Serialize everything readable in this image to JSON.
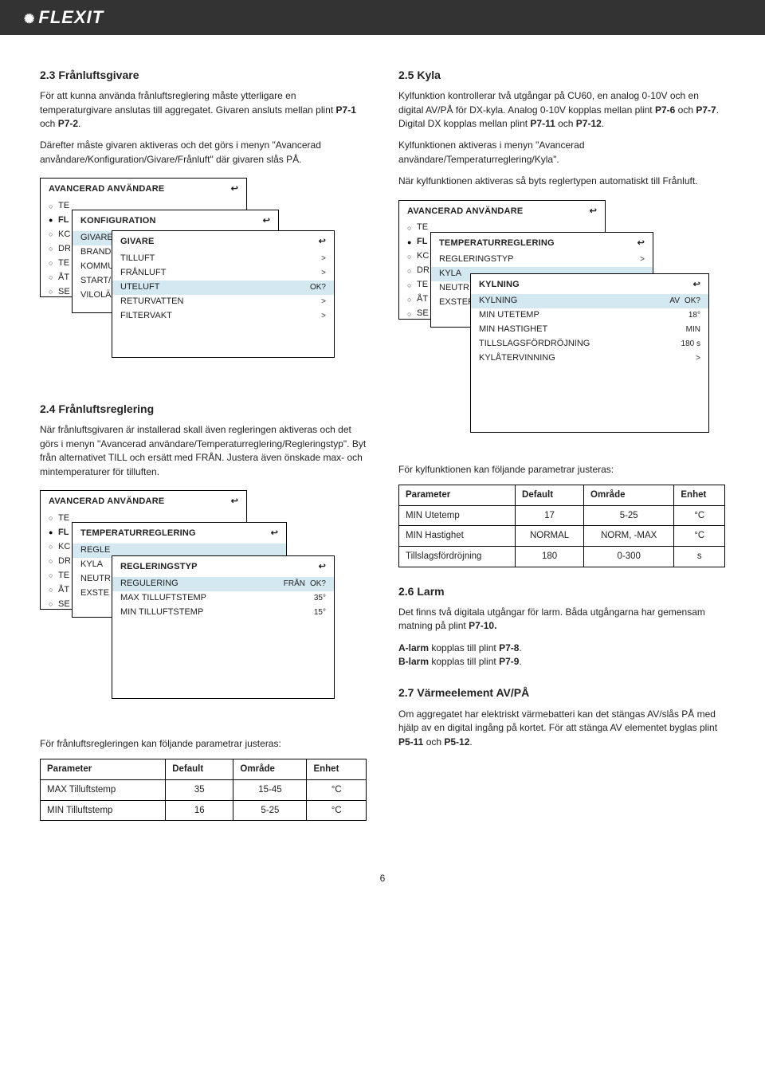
{
  "brand": "FLEXIT",
  "s23": {
    "heading": "2.3 Frånluftsgivare",
    "p1a": "För att kunna använda frånluftsreglering måste ytterligare en temperaturgivare anslutas till aggregatet. Givaren ansluts mellan plint ",
    "p1b": "P7-1",
    "p1c": " och ",
    "p1d": "P7-2",
    "p1e": ".",
    "p2": "Därefter måste givaren aktiveras och det görs i menyn \"Avancerad anvåndare/Konfiguration/Givare/Frånluft\" där givaren slås PÅ."
  },
  "cascades23": {
    "m1_title": "AVANCERAD ANVÄNDARE",
    "m1_items": [
      "TE",
      "FL",
      "KC",
      "DR",
      "TE",
      "ÅT",
      "SE"
    ],
    "m2_title": "KONFIGURATION",
    "m2_items": [
      "GIVARE",
      "BRAND",
      "KOMMU",
      "START/",
      "VILOLÄ"
    ],
    "m3_title": "GIVARE",
    "m3_rows": [
      {
        "label": "TILLUFT",
        "chev": ">"
      },
      {
        "label": "FRÅNLUFT",
        "chev": ">"
      },
      {
        "label": "UTELUFT",
        "chev": "",
        "ok": "OK?",
        "selected": true
      },
      {
        "label": "RETURVATTEN",
        "chev": ">"
      },
      {
        "label": "FILTERVAKT",
        "chev": ">"
      }
    ]
  },
  "s24": {
    "heading": "2.4 Frånluftsreglering",
    "p1": "När frånluftsgivaren är installerad skall även regleringen aktiveras och det görs i menyn \"Avancerad användare/Temperaturreglering/Regleringstyp\". Byt från alternativet TILL och ersätt med FRÅN. Justera även önskade max- och mintemperaturer för tilluften."
  },
  "cascades24": {
    "m1_title": "AVANCERAD ANVÄNDARE",
    "m1_items": [
      "TE",
      "FL",
      "KC",
      "DR",
      "TE",
      "ÅT",
      "SE"
    ],
    "m2_title": "TEMPERATURREGLERING",
    "m2_items": [
      "REGLE",
      "KYLA",
      "NEUTR",
      "EXSTE"
    ],
    "m3_title": "REGLERINGSTYP",
    "m3_rows": [
      {
        "label": "REGULERING",
        "val": "FRÅN",
        "ok": "OK?",
        "selected": true
      },
      {
        "label": "MAX TILLUFTSTEMP",
        "val": "35°"
      },
      {
        "label": "MIN TILLUFTSTEMP",
        "val": "15°"
      }
    ]
  },
  "s24_tbl_intro": "För frånluftsregleringen kan följande parametrar justeras:",
  "s24_table": {
    "headers": [
      "Parameter",
      "Default",
      "Område",
      "Enhet"
    ],
    "rows": [
      [
        "MAX Tilluftstemp",
        "35",
        "15-45",
        "°C"
      ],
      [
        "MIN Tilluftstemp",
        "16",
        "5-25",
        "°C"
      ]
    ]
  },
  "s25": {
    "heading": "2.5 Kyla",
    "p1a": "Kylfunktion kontrollerar två utgångar på CU60, en analog 0-10V och en digital AV/PÅ för DX-kyla. Analog 0-10V kopplas mellan plint ",
    "p1b": "P7-6",
    "p1c": " och ",
    "p1d": "P7-7",
    "p1e": ". Digital DX kopplas mellan plint ",
    "p1f": "P7-11",
    "p1g": " och ",
    "p1h": "P7-12",
    "p1i": ".",
    "p2": "Kylfunktionen aktiveras i menyn \"Avancerad användare/Temperaturreglering/Kyla\".",
    "p3": "När kylfunktionen aktiveras så byts reglertypen automatiskt till Frånluft."
  },
  "cascades25": {
    "m1_title": "AVANCERAD ANVÄNDARE",
    "m1_items": [
      "TE",
      "FL",
      "KC",
      "DR",
      "TE",
      "ÅT",
      "SE"
    ],
    "m2_title": "TEMPERATURREGLERING",
    "m2_items": [
      "REGLERINGSTYP",
      "KYLA",
      "NEUTR",
      "EXSTER"
    ],
    "m3_title": "KYLNING",
    "m3_rows": [
      {
        "label": "KYLNING",
        "val": "AV",
        "ok": "OK?",
        "selected": true
      },
      {
        "label": "MIN UTETEMP",
        "val": "18°"
      },
      {
        "label": "MIN HASTIGHET",
        "val": "MIN"
      },
      {
        "label": "TILLSLAGSFÖRDRÖJNING",
        "val": "180 s"
      },
      {
        "label": "KYLÅTERVINNING",
        "chev": ">"
      }
    ]
  },
  "s25_tbl_intro": "För kylfunktionen kan följande parametrar justeras:",
  "s25_table": {
    "headers": [
      "Parameter",
      "Default",
      "Område",
      "Enhet"
    ],
    "rows": [
      [
        "MIN Utetemp",
        "17",
        "5-25",
        "°C"
      ],
      [
        "MIN Hastighet",
        "NORMAL",
        "NORM, -MAX",
        "°C"
      ],
      [
        "Tillslagsfördröjning",
        "180",
        "0-300",
        "s"
      ]
    ]
  },
  "s26": {
    "heading": "2.6 Larm",
    "p1a": "Det finns två digitala utgångar för larm. Båda utgångarna har gemensam matning på plint ",
    "p1b": "P7-10.",
    "p2a": "A-larm",
    "p2b": " kopplas till plint ",
    "p2c": "P7-8",
    "p2d": ".",
    "p3a": "B-larm",
    "p3b": " kopplas till plint ",
    "p3c": "P7-9",
    "p3d": "."
  },
  "s27": {
    "heading": "2.7 Värmeelement AV/PÅ",
    "p1a": "Om aggregatet har elektriskt värmebatteri kan det stängas AV/slås PÅ med hjälp av en digital ingång på kortet. För att stänga AV elementet byglas plint ",
    "p1b": "P5-11",
    "p1c": " och ",
    "p1d": "P5-12",
    "p1e": "."
  },
  "page_number": "6"
}
